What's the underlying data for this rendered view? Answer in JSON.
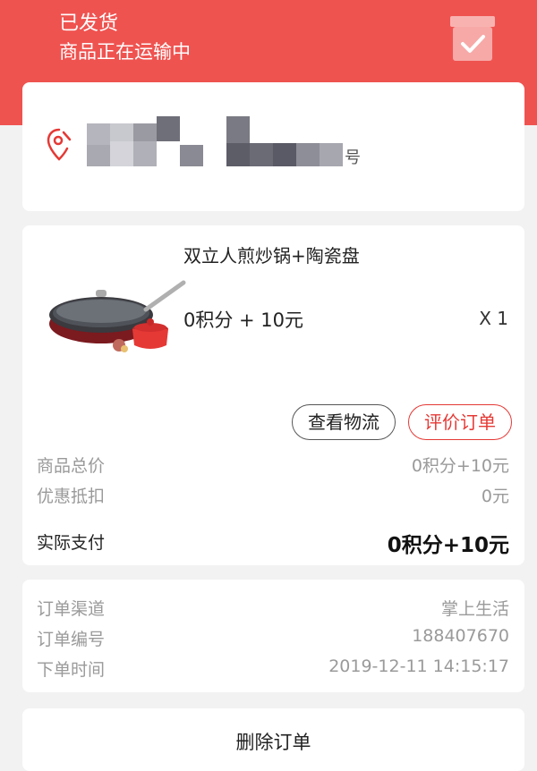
{
  "header": {
    "status": "已发货",
    "substatus": "商品正在运输中",
    "icon": "box-check-icon"
  },
  "address": {
    "suffix": "号",
    "icon": "location-pin-icon"
  },
  "product": {
    "name": "双立人煎炒锅+陶瓷盘",
    "price": "0积分 + 10元",
    "quantity": "X 1",
    "buttons": {
      "logistics": "查看物流",
      "review": "评价订单"
    }
  },
  "pricing": {
    "rows": [
      {
        "label": "商品总价",
        "value": "0积分+10元"
      },
      {
        "label": "优惠抵扣",
        "value": "0元"
      },
      {
        "label": "实际支付",
        "value": "0积分+10元"
      }
    ]
  },
  "order_info": {
    "rows": [
      {
        "label": "订单渠道",
        "value": "掌上生活"
      },
      {
        "label": "订单编号",
        "value": "188407670"
      },
      {
        "label": "下单时间",
        "value": "2019-12-11 14:15:17"
      }
    ]
  },
  "actions": {
    "delete": "删除订单"
  },
  "colors": {
    "accent": "#ef5350",
    "review_red": "#e53935"
  }
}
